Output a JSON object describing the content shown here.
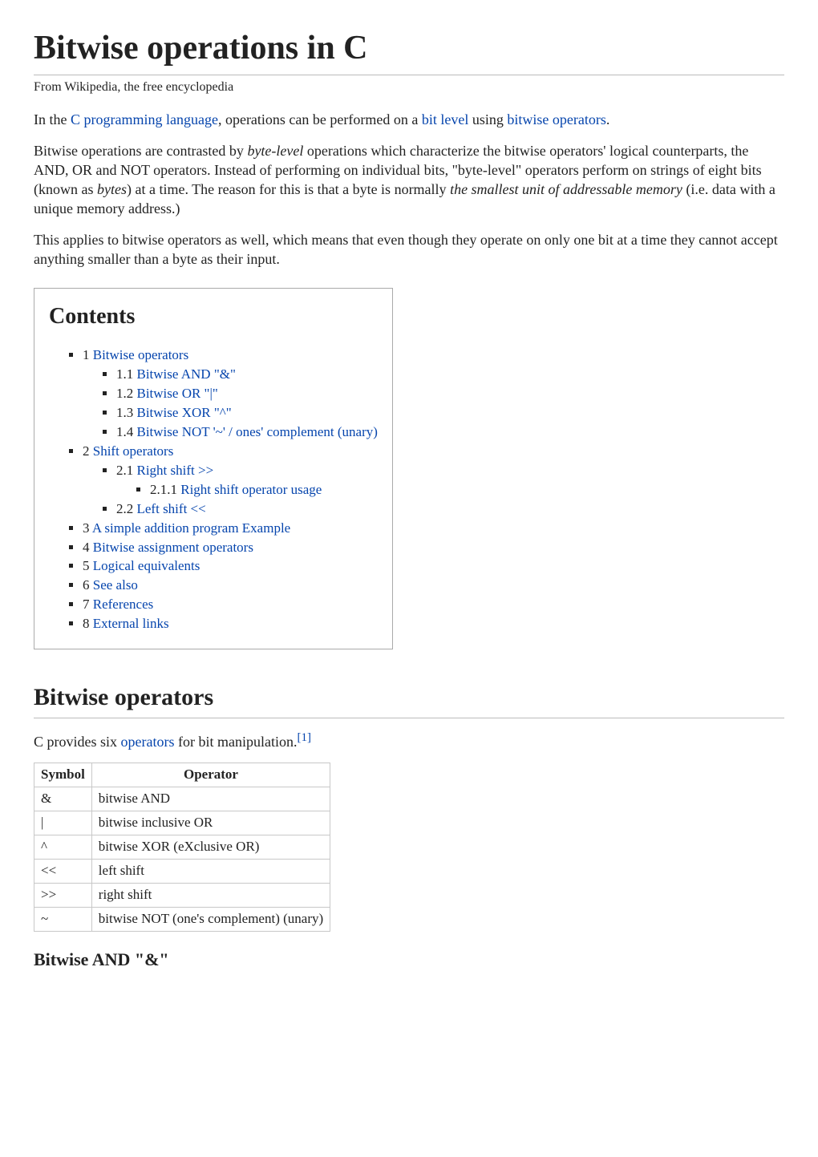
{
  "header": {
    "title": "Bitwise operations in C",
    "subtitle": "From Wikipedia, the free encyclopedia"
  },
  "intro": {
    "p1a": "In the ",
    "p1_link1": "C programming language",
    "p1b": ", operations can be performed on a ",
    "p1_link2": "bit level",
    "p1c": " using ",
    "p1_link3": "bitwise operators",
    "p1d": ".",
    "p2a": "Bitwise operations are contrasted by ",
    "p2_em1": "byte-level",
    "p2b": " operations which characterize the bitwise operators' logical counterparts, the AND, OR and NOT operators. Instead of performing on individual bits, \"byte-level\" operators perform on strings of eight bits (known as ",
    "p2_em2": "bytes",
    "p2c": ") at a time. The reason for this is that a byte is normally ",
    "p2_em3": "the smallest unit of addressable memory",
    "p2d": " (i.e. data with a unique memory address.)",
    "p3": "This applies to bitwise operators as well, which means that even though they operate on only one bit at a time they cannot accept anything smaller than a byte as their input."
  },
  "toc": {
    "heading": "Contents",
    "items": [
      {
        "num": "1",
        "label": "Bitwise operators",
        "children": [
          {
            "num": "1.1",
            "label": "Bitwise AND \"&\""
          },
          {
            "num": "1.2",
            "label": "Bitwise OR \"|\""
          },
          {
            "num": "1.3",
            "label": "Bitwise XOR \"^\""
          },
          {
            "num": "1.4",
            "label": "Bitwise NOT '~' / ones' complement (unary)"
          }
        ]
      },
      {
        "num": "2",
        "label": "Shift operators",
        "children": [
          {
            "num": "2.1",
            "label": "Right shift >>",
            "children": [
              {
                "num": "2.1.1",
                "label": "Right shift operator usage"
              }
            ]
          },
          {
            "num": "2.2",
            "label": "Left shift <<"
          }
        ]
      },
      {
        "num": "3",
        "label": "A simple addition program Example"
      },
      {
        "num": "4",
        "label": "Bitwise assignment operators"
      },
      {
        "num": "5",
        "label": "Logical equivalents"
      },
      {
        "num": "6",
        "label": "See also"
      },
      {
        "num": "7",
        "label": "References"
      },
      {
        "num": "8",
        "label": "External links"
      }
    ]
  },
  "section1": {
    "heading": "Bitwise operators",
    "p1a": "C provides six ",
    "p1_link": "operators",
    "p1b": " for bit manipulation.",
    "ref": "[1]"
  },
  "optable": {
    "headers": [
      "Symbol",
      "Operator"
    ],
    "rows": [
      [
        "&",
        "bitwise AND"
      ],
      [
        "|",
        "bitwise inclusive OR"
      ],
      [
        "^",
        "bitwise XOR (eXclusive OR)"
      ],
      [
        "<<",
        "left shift"
      ],
      [
        ">>",
        "right shift"
      ],
      [
        "~",
        "bitwise NOT (one's complement) (unary)"
      ]
    ]
  },
  "subsection1": {
    "heading": "Bitwise AND \"&\""
  }
}
